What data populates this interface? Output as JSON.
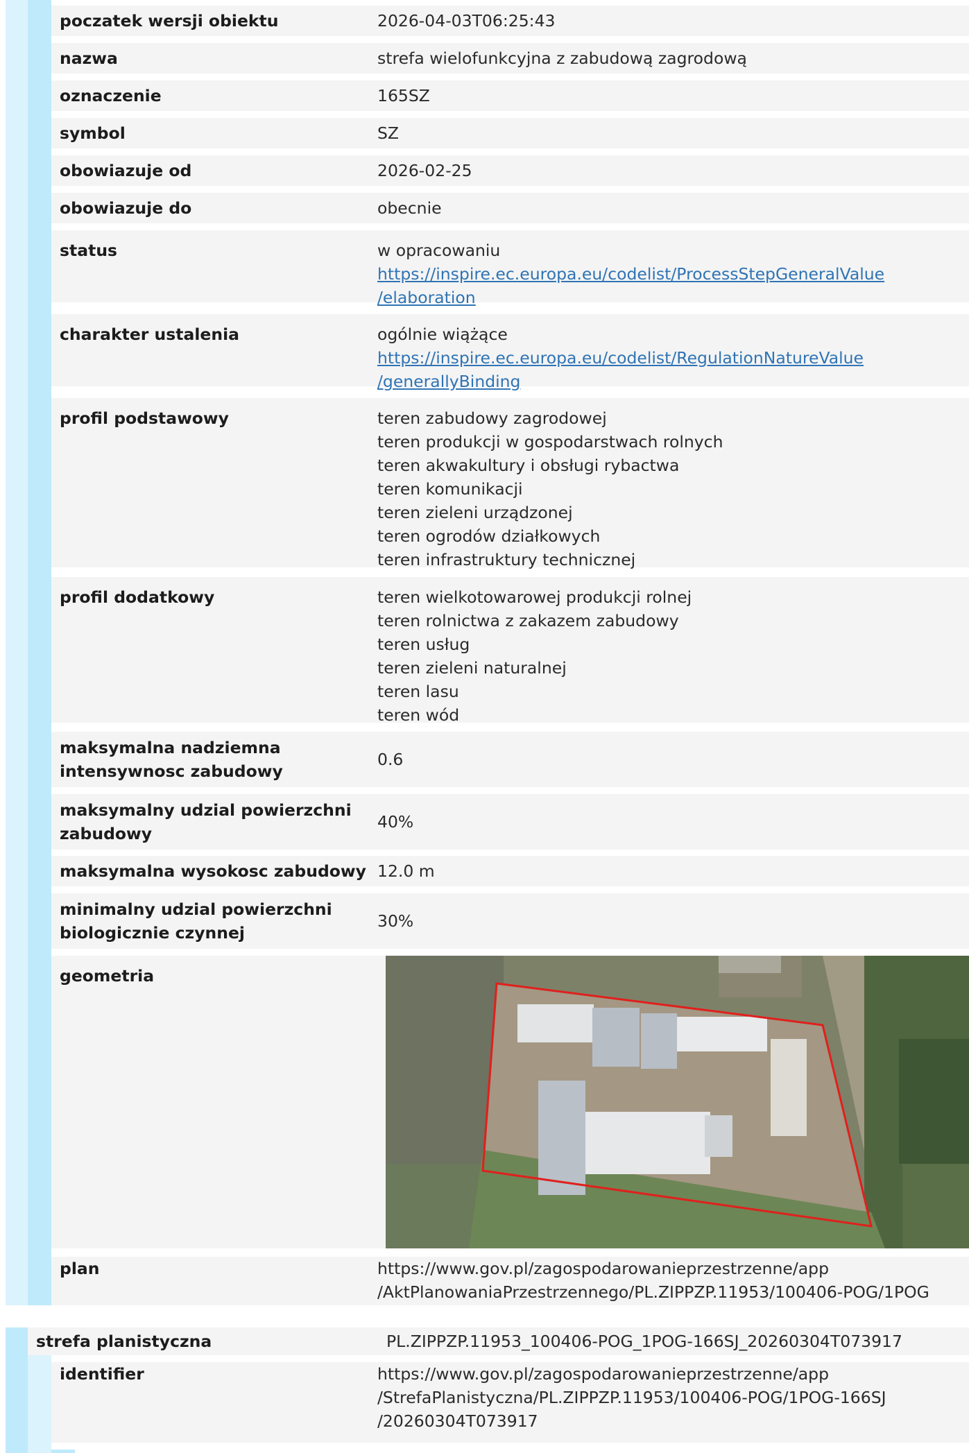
{
  "rows": {
    "poczatek": {
      "label": "poczatek wersji obiektu",
      "value": "2026-04-03T06:25:43"
    },
    "nazwa": {
      "label": "nazwa",
      "value": "strefa wielofunkcyjna z zabudową zagrodową"
    },
    "oznaczenie": {
      "label": "oznaczenie",
      "value": "165SZ"
    },
    "symbol": {
      "label": "symbol",
      "value": "SZ"
    },
    "obowiazuje_od": {
      "label": "obowiazuje od",
      "value": "2026-02-25"
    },
    "obowiazuje_do": {
      "label": "obowiazuje do",
      "value": "obecnie"
    },
    "status": {
      "label": "status",
      "text": "w opracowaniu",
      "link_line1": "https://inspire.ec.europa.eu/codelist/ProcessStepGeneralValue",
      "link_line2": "/elaboration"
    },
    "charakter": {
      "label": "charakter ustalenia",
      "text": "ogólnie wiążące",
      "link_line1": "https://inspire.ec.europa.eu/codelist/RegulationNatureValue",
      "link_line2": "/generallyBinding"
    },
    "profil_podstawowy": {
      "label": "profil podstawowy",
      "items": [
        "teren zabudowy zagrodowej",
        "teren produkcji w gospodarstwach rolnych",
        "teren akwakultury i obsługi rybactwa",
        "teren komunikacji",
        "teren zieleni urządzonej",
        "teren ogrodów działkowych",
        "teren infrastruktury technicznej"
      ]
    },
    "profil_dodatkowy": {
      "label": "profil dodatkowy",
      "items": [
        "teren wielkotowarowej produkcji rolnej",
        "teren rolnictwa z zakazem zabudowy",
        "teren usług",
        "teren zieleni naturalnej",
        "teren lasu",
        "teren wód"
      ]
    },
    "intensywnosc": {
      "label_line1": "maksymalna nadziemna",
      "label_line2": "intensywnosc zabudowy",
      "value": "0.6"
    },
    "udzial": {
      "label_line1": "maksymalny udzial powierzchni",
      "label_line2": "zabudowy",
      "value": "40%"
    },
    "wysokosc": {
      "label": "maksymalna wysokosc zabudowy",
      "value": "12.0 m"
    },
    "biologicznie": {
      "label_line1": "minimalny udzial powierzchni",
      "label_line2": "biologicznie czynnej",
      "value": "30%"
    },
    "geometria": {
      "label": "geometria"
    },
    "plan": {
      "label": "plan",
      "line1": "https://www.gov.pl/zagospodarowanieprzestrzenne/app",
      "line2": "/AktPlanowaniaPrzestrzennego/PL.ZIPPZP.11953/100406-POG/1POG"
    }
  },
  "section": {
    "label": "strefa planistyczna",
    "value": "PL.ZIPPZP.11953_100406-POG_1POG-166SJ_20260304T073917",
    "identifier": {
      "label": "identifier",
      "line1": "https://www.gov.pl/zagospodarowanieprzestrzenne/app",
      "line2": "/StrefaPlanistyczna/PL.ZIPPZP.11953/100406-POG/1POG-166SJ",
      "line3": "/20260304T073917"
    }
  },
  "colors": {
    "outer_bar": "#dbf3fd",
    "inner_bar": "#bfeafb",
    "row_bg": "#f4f4f4",
    "link": "#2f74b5",
    "polygon": "#e0201c"
  }
}
